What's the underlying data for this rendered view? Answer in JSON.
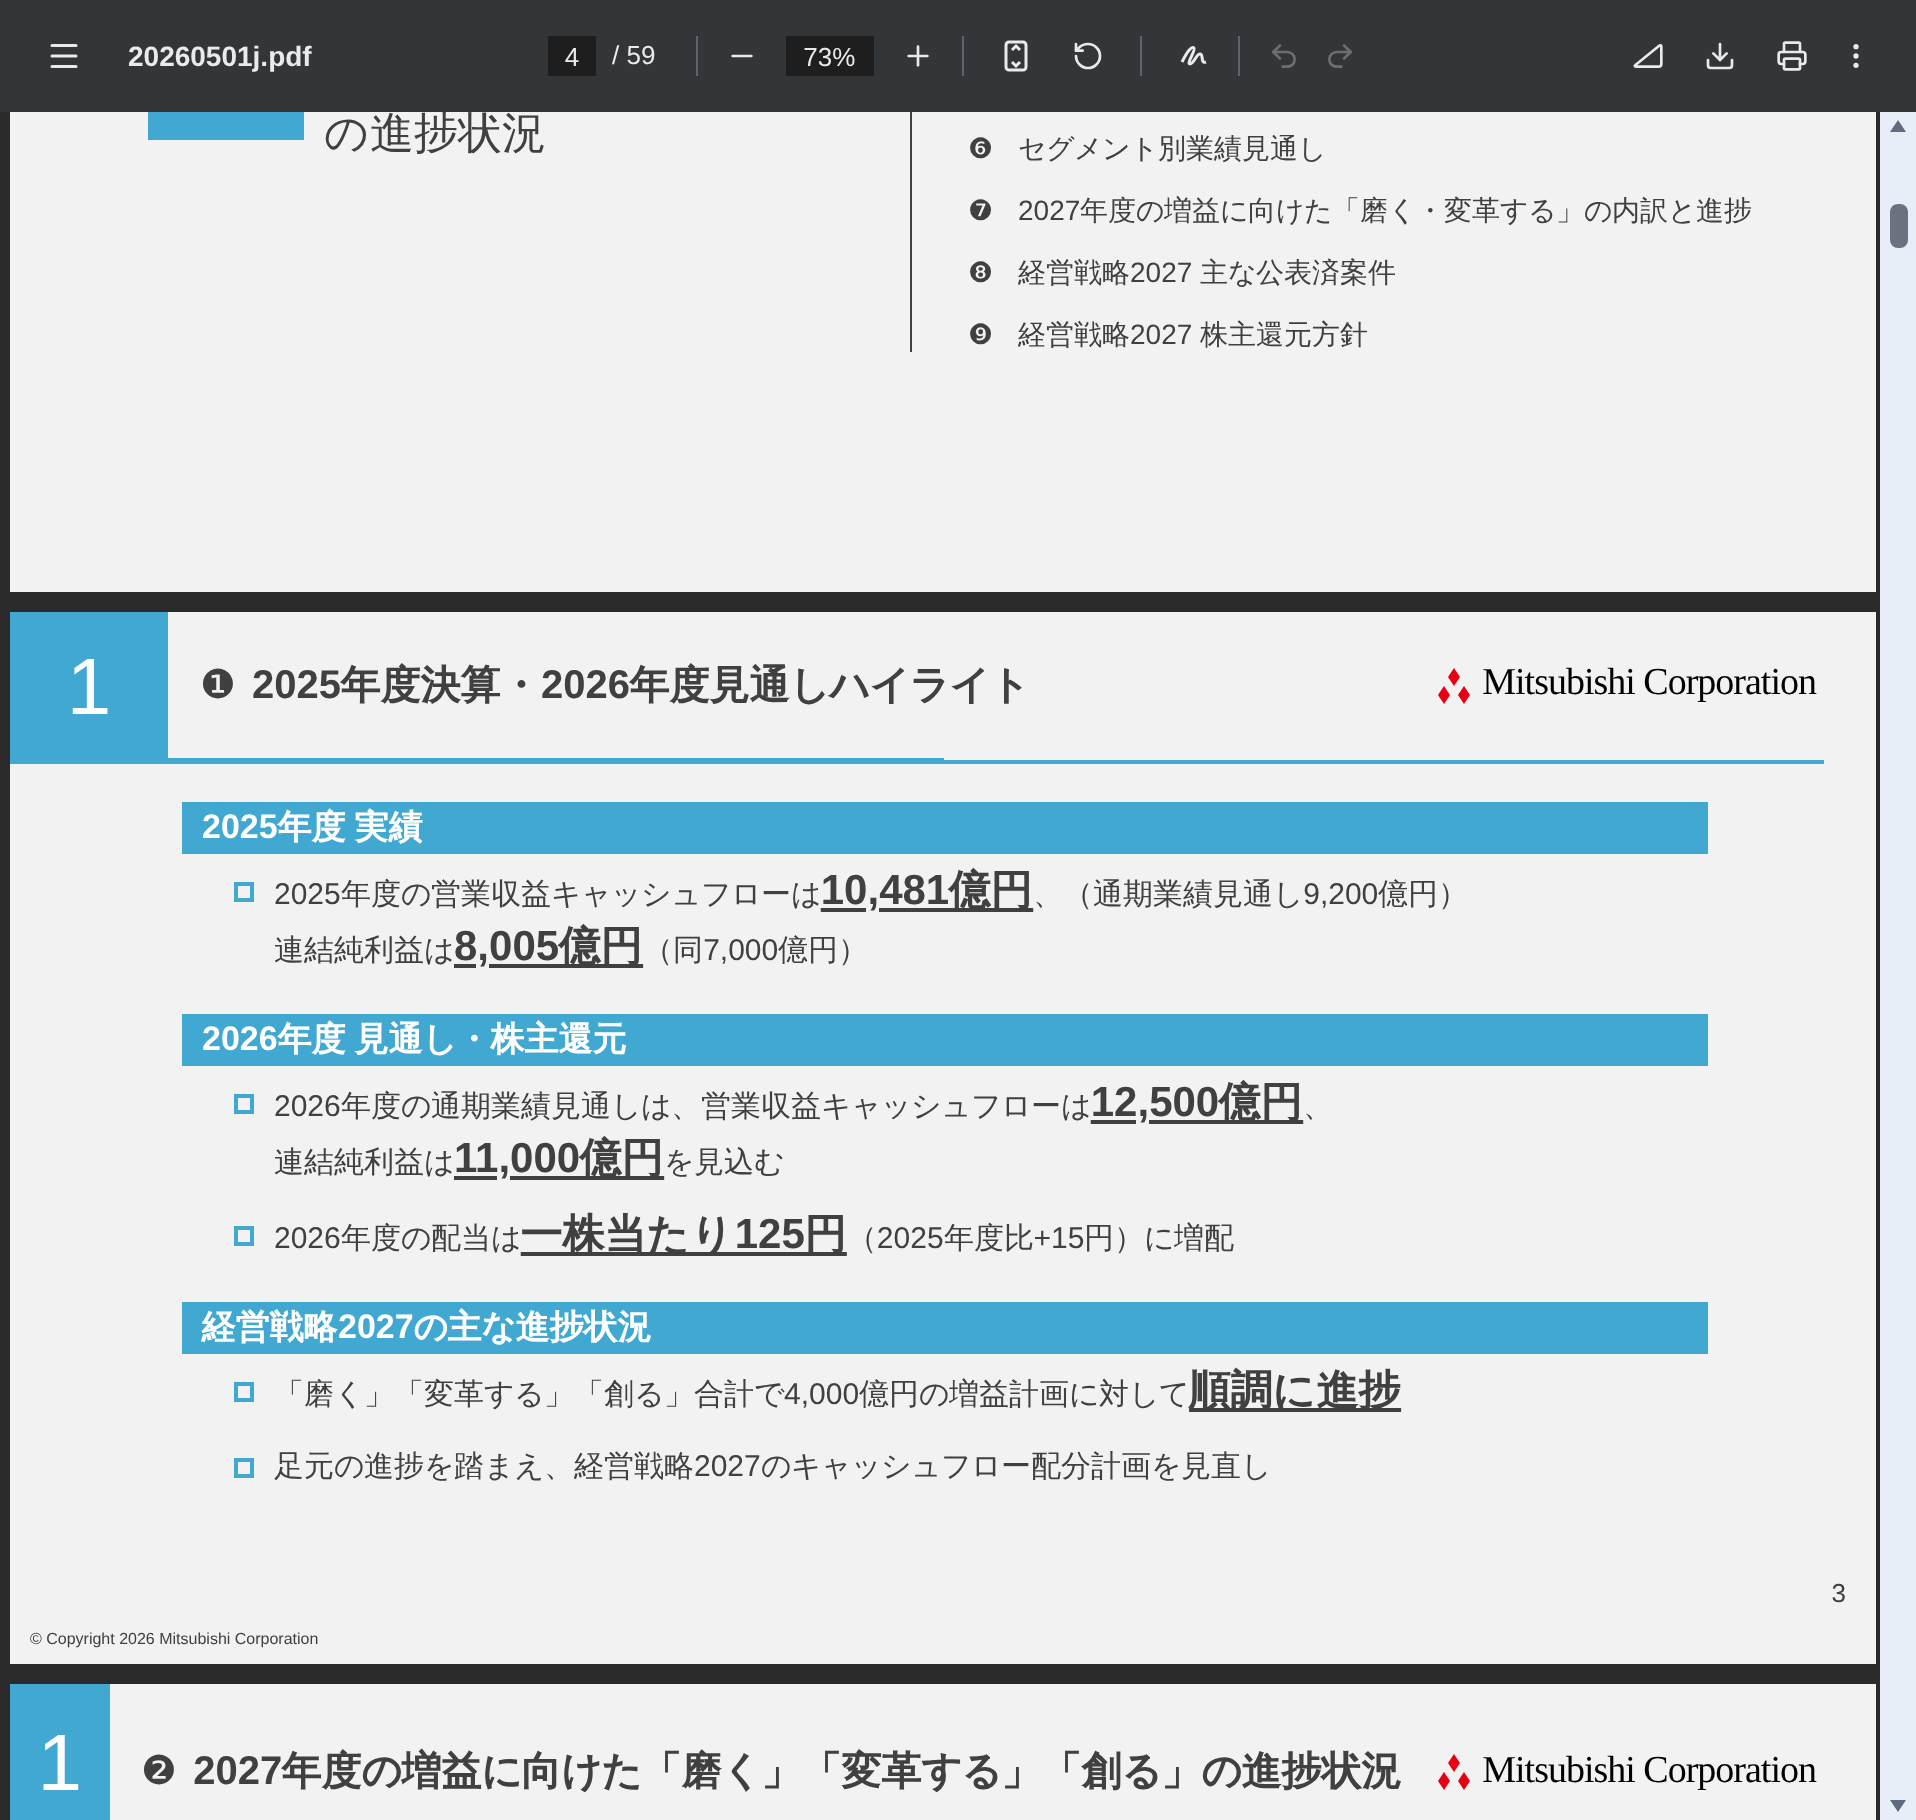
{
  "toolbar": {
    "title": "20260501j.pdf",
    "page_input": "4",
    "page_total": "/ 59",
    "zoom": "73%",
    "history": [
      {
        "kind": "undo",
        "disabled": true
      },
      {
        "kind": "redo",
        "disabled": true
      }
    ]
  },
  "previous_page": {
    "title": "の進捗状況",
    "contents": [
      {
        "marker": "❻",
        "text": "セグメント別業績見通し"
      },
      {
        "marker": "❼",
        "text": "2027年度の増益に向けた「磨く・変革する」の内訳と進捗"
      },
      {
        "marker": "❽",
        "text": "経営戦略2027 主な公表済案件"
      },
      {
        "marker": "❾",
        "text": "経営戦略2027 株主還元方針"
      }
    ]
  },
  "slide": {
    "section_number": "1",
    "marker": "❶",
    "title": "2025年度決算・2026年度見通しハイライト",
    "logo_text": "Mitsubishi Corporation",
    "sections": [
      {
        "heading": "2025年度 実績",
        "bullets": [
          [
            "2025年度の営業収益キャッシュフローは**10,481億円**、（通期業績見通し9,200億円）",
            "連結純利益は**8,005億円**（同7,000億円）"
          ]
        ]
      },
      {
        "heading": "2026年度 見通し・株主還元",
        "bullets": [
          [
            "2026年度の通期業績見通しは、営業収益キャッシュフローは**12,500億円**、",
            "連結純利益は**11,000億円**を見込む"
          ],
          [
            "2026年度の配当は**一株当たり125円**（2025年度比+15円）に増配"
          ]
        ]
      },
      {
        "heading": "経営戦略2027の主な進捗状況",
        "bullets": [
          [
            "「磨く」「変革する」「創る」合計で4,000億円の増益計画に対して**順調に進捗**"
          ],
          [
            "足元の進捗を踏まえ、経営戦略2027のキャッシュフロー配分計画を見直し"
          ]
        ]
      }
    ],
    "page_number": "3",
    "copyright": "© Copyright 2026 Mitsubishi Corporation"
  },
  "next_slide": {
    "section_number": "1",
    "marker": "❷",
    "title": "2027年度の増益に向けた「磨く」「変革する」「創る」の進捗状況",
    "logo_text": "Mitsubishi Corporation"
  }
}
